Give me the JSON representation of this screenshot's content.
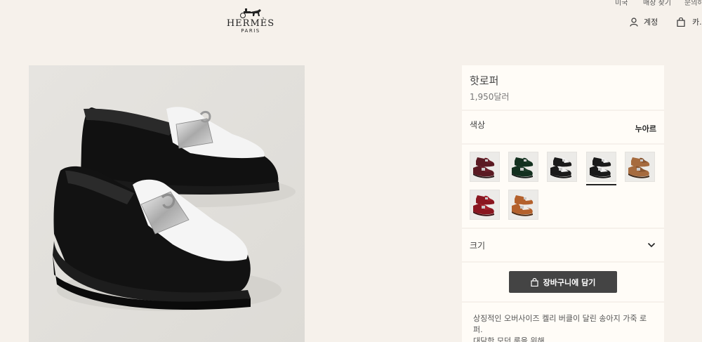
{
  "header": {
    "brand": "HERMÈS",
    "city": "PARIS",
    "top_links": [
      "미국",
      "매장 찾기",
      "문의하"
    ],
    "account_label": "계정",
    "cart_label": "카."
  },
  "product": {
    "name": "핫로퍼",
    "price": "1,950달러",
    "color_label": "색상",
    "color_value": "누아르",
    "size_label": "크기",
    "add_to_cart_label": "장바구니에 담기",
    "description": "상징적인 오버사이즈 켈리 버클이 달린 송아지 가죽 로퍼.",
    "description_more": "대담한 모던 룩을 위해"
  },
  "swatches": [
    {
      "name": "burgundy",
      "upper": "#5a1a22",
      "vamp": "#6a1f29",
      "sole": "#2a1a1a",
      "selected": false
    },
    {
      "name": "green",
      "upper": "#13301f",
      "vamp": "#1c3a28",
      "sole": "#151a17",
      "selected": false
    },
    {
      "name": "black-white",
      "upper": "#1a1a1a",
      "vamp": "#f2f2f2",
      "sole": "#111111",
      "selected": false
    },
    {
      "name": "black-white-selected",
      "upper": "#1a1a1a",
      "vamp": "#f2f2f2",
      "sole": "#111111",
      "selected": true
    },
    {
      "name": "tan",
      "upper": "#a66b3e",
      "vamp": "#8a5630",
      "sole": "#3a2414",
      "selected": false
    },
    {
      "name": "red-suede",
      "upper": "#8a1720",
      "vamp": "#a3202a",
      "sole": "#3a0e10",
      "selected": false
    },
    {
      "name": "cognac-white",
      "upper": "#b4612c",
      "vamp": "#f1ece6",
      "sole": "#4a2810",
      "selected": false
    }
  ],
  "colors": {
    "page_background": "#f6f1eb",
    "card_background": "#fffcf7",
    "button_background": "#444444"
  }
}
